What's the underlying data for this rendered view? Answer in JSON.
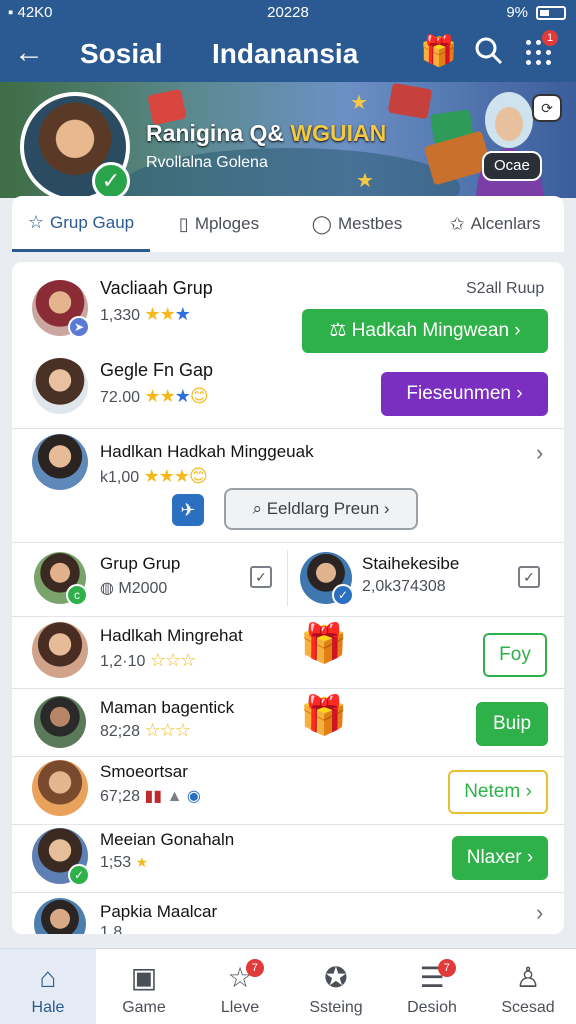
{
  "status_bar": {
    "left": "▪ 42K0",
    "center": "20228",
    "right": "9%"
  },
  "app_bar": {
    "title": "Sosial",
    "subtitle": "Indanansia",
    "notification_count": "1"
  },
  "banner": {
    "title_part1": "Ranigina Q& ",
    "title_part2": "WGUIAN",
    "subtitle": "Rvollalna Golena",
    "action_label": "Ocae"
  },
  "tabs": [
    {
      "label": "Grup Gaup",
      "icon": "star-icon"
    },
    {
      "label": "Mploges",
      "icon": "badge-icon"
    },
    {
      "label": "Mestbes",
      "icon": "chat-icon"
    },
    {
      "label": "Alcenlars",
      "icon": "star-outline-icon"
    }
  ],
  "list": {
    "header_right": "S2all Ruup",
    "items": [
      {
        "name": "Vacliaah Grup",
        "meta": "1,330",
        "stars": 3,
        "button": "Hadkah Mingwean",
        "button_style": "green"
      },
      {
        "name": "Gegle Fn Gap",
        "meta": "72.00",
        "stars": 3,
        "button": "Fieseunmen",
        "button_style": "purple"
      },
      {
        "name": "Hadlkan Hadkah Minggeuak",
        "meta": "k1,00",
        "stars": 3,
        "search_label": "Eeldlarg Preun"
      },
      {
        "name": "Grup Grup",
        "meta": "M2000"
      },
      {
        "name": "Staihekesibe",
        "meta": "2,0k374308"
      },
      {
        "name": "Hadlkah Mingrehat",
        "meta": "1,2·10",
        "stars": 3,
        "button": "Foy",
        "button_style": "outline"
      },
      {
        "name": "Maman bagentick",
        "meta": "82;28",
        "stars": 3,
        "button": "Buip",
        "button_style": "green"
      },
      {
        "name": "Smoeortsar",
        "meta": "67;28",
        "button": "Netem",
        "button_style": "outline-y"
      },
      {
        "name": "Meeian Gonahaln",
        "meta": "1;53",
        "stars": 1,
        "button": "Nlaxer",
        "button_style": "green"
      },
      {
        "name": "Papkia Maalcar",
        "meta": "1.8"
      }
    ]
  },
  "bottom_nav": [
    {
      "label": "Hale",
      "icon": "home-icon"
    },
    {
      "label": "Game",
      "icon": "game-icon"
    },
    {
      "label": "Lleve",
      "icon": "star-icon",
      "badge": "7"
    },
    {
      "label": "Ssteing",
      "icon": "trophy-icon"
    },
    {
      "label": "Desioh",
      "icon": "message-icon",
      "badge": "7"
    },
    {
      "label": "Scesad",
      "icon": "profile-icon"
    }
  ],
  "colors": {
    "primary": "#2b5a92",
    "green": "#2fb14a",
    "purple": "#7b2fc0",
    "star": "#f5b91d"
  }
}
